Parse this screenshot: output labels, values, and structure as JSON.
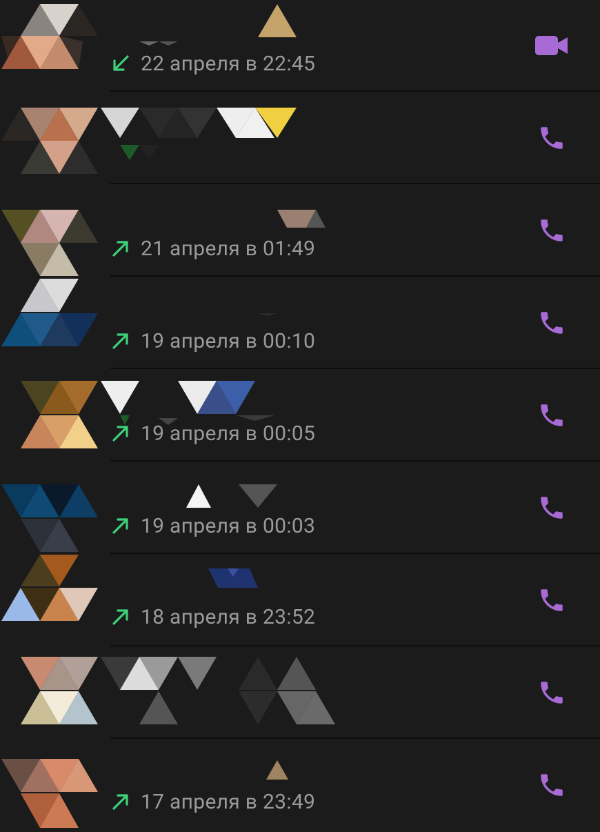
{
  "theme": {
    "background": "#1b1b1b",
    "accent_purple": "#a86bd6",
    "arrow_green": "#3dd17a",
    "time_gray": "#9a9a9a"
  },
  "calls": [
    {
      "time": "22 апреля в 22:45",
      "direction": "incoming",
      "direction_icon": "arrow-down-left-icon",
      "action_icon": "video-camera-icon"
    },
    {
      "time": "",
      "direction": "",
      "direction_icon": "",
      "action_icon": "phone-icon"
    },
    {
      "time": "21 апреля в 01:49",
      "direction": "outgoing",
      "direction_icon": "arrow-up-right-icon",
      "action_icon": "phone-icon"
    },
    {
      "time": "19 апреля в 00:10",
      "direction": "outgoing",
      "direction_icon": "arrow-up-right-icon",
      "action_icon": "phone-icon"
    },
    {
      "time": "19 апреля в 00:05",
      "direction": "outgoing",
      "direction_icon": "arrow-up-right-icon",
      "action_icon": "phone-icon"
    },
    {
      "time": "19 апреля в 00:03",
      "direction": "outgoing",
      "direction_icon": "arrow-up-right-icon",
      "action_icon": "phone-icon"
    },
    {
      "time": "18 апреля в 23:52",
      "direction": "outgoing",
      "direction_icon": "arrow-up-right-icon",
      "action_icon": "phone-icon"
    },
    {
      "time": "",
      "direction": "",
      "direction_icon": "",
      "action_icon": "phone-icon"
    },
    {
      "time": "17 апреля в 23:49",
      "direction": "outgoing",
      "direction_icon": "arrow-up-right-icon",
      "action_icon": "phone-icon"
    }
  ]
}
